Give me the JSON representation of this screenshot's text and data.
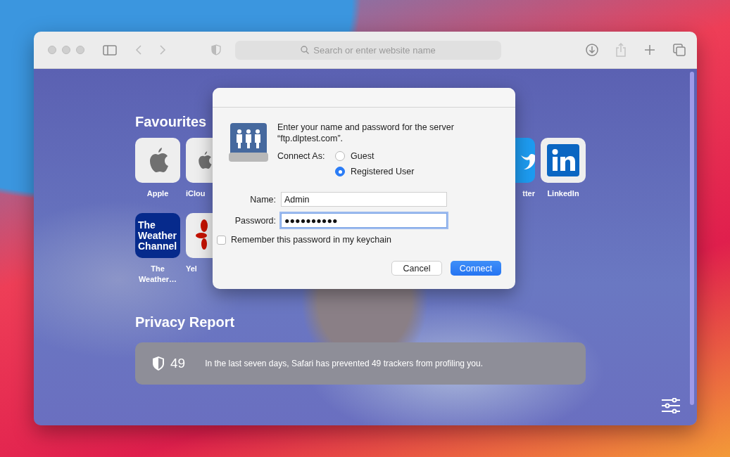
{
  "toolbar": {
    "search": {
      "placeholder": "Search or enter website name"
    }
  },
  "favourites": {
    "title": "Favourites",
    "rows": [
      {
        "left": [
          {
            "label": "Apple",
            "kind": "apple",
            "cut": false
          },
          {
            "label": "iClou",
            "kind": "apple",
            "cut": true
          }
        ],
        "right": [
          {
            "label": "tter",
            "kind": "twitter",
            "cut": true
          },
          {
            "label": "LinkedIn",
            "kind": "linkedin",
            "cut": false
          }
        ]
      },
      {
        "left": [
          {
            "label": "The Weather…",
            "kind": "weather",
            "logo_text": "The Weather Channel",
            "cut": false
          },
          {
            "label": "Yel",
            "kind": "yelp",
            "cut": true
          }
        ]
      }
    ]
  },
  "privacy_report": {
    "title": "Privacy Report",
    "count": "49",
    "message": "In the last seven days, Safari has prevented 49 trackers from profiling you."
  },
  "dialog": {
    "message": "Enter your name and password for the server “ftp.dlptest.com”.",
    "connect_as": {
      "label": "Connect As:",
      "options": [
        {
          "label": "Guest",
          "selected": false
        },
        {
          "label": "Registered User",
          "selected": true
        }
      ]
    },
    "fields": [
      {
        "label": "Name:",
        "value": "Admin",
        "focused": false
      },
      {
        "label": "Password:",
        "value": "●●●●●●●●●●",
        "focused": true
      }
    ],
    "remember": {
      "label": "Remember this password in my keychain",
      "checked": false
    },
    "buttons": [
      {
        "label": "Cancel",
        "kind": "default"
      },
      {
        "label": "Connect",
        "kind": "primary"
      }
    ]
  }
}
